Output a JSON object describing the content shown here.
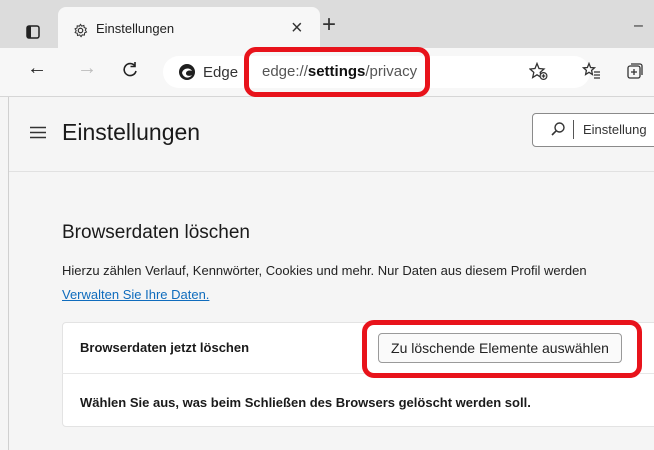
{
  "tab": {
    "title": "Einstellungen",
    "close_glyph": "×",
    "new_tab_glyph": "+",
    "minimize_glyph": "–"
  },
  "toolbar": {
    "back_glyph": "←",
    "forward_glyph": "→",
    "reload_glyph": "C",
    "edge_label": "Edge",
    "url_prefix": "edge://",
    "url_bold": "settings",
    "url_suffix": "/privacy"
  },
  "settings": {
    "title": "Einstellungen",
    "search_placeholder": "Einstellung"
  },
  "section": {
    "title": "Browserdaten löschen",
    "description": "Hierzu zählen Verlauf, Kennwörter, Cookies und mehr. Nur Daten aus diesem Profil werden",
    "manage_link": "Verwalten Sie Ihre Daten.",
    "row1_label": "Browserdaten jetzt löschen",
    "row1_button": "Zu löschende Elemente auswählen",
    "row2_label": "Wählen Sie aus, was beim Schließen des Browsers gelöscht werden soll."
  },
  "colors": {
    "highlight": "#e8131b",
    "link": "#0f6cbd"
  }
}
